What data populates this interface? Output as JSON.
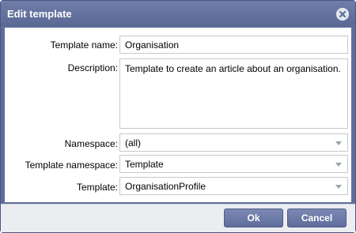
{
  "dialog": {
    "title": "Edit template",
    "close_icon": "close-icon"
  },
  "form": {
    "template_name": {
      "label": "Template name:",
      "value": "Organisation"
    },
    "description": {
      "label": "Description:",
      "value": "Template to create an article about an organisation."
    },
    "namespace": {
      "label": "Namespace:",
      "value": "(all)"
    },
    "template_namespace": {
      "label": "Template namespace:",
      "value": "Template"
    },
    "template": {
      "label": "Template:",
      "value": "OrganisationProfile"
    }
  },
  "buttons": {
    "ok_label": "Ok",
    "cancel_label": "Cancel"
  },
  "colors": {
    "titlebar": "#5f6e99",
    "button": "#6b79a6"
  }
}
